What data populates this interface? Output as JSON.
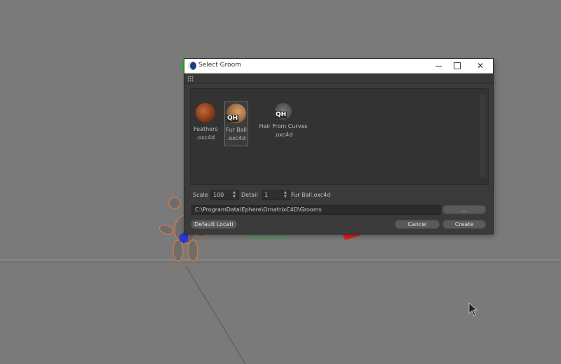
{
  "dialog": {
    "title": "Select Groom",
    "items": [
      {
        "name": "Feathers",
        "ext": ".oxc4d"
      },
      {
        "name": "Fur Ball",
        "ext": ".oxc4d",
        "badge": "QH",
        "selected": true
      },
      {
        "name": "Hair From Curves",
        "ext": ".oxc4d",
        "badge": "QH"
      }
    ],
    "scale_label": "Scale",
    "scale_value": "100",
    "detail_label": "Detail",
    "detail_value": "1",
    "selected_name": "Fur Ball.oxc4d",
    "path": "C:\\ProgramData\\Ephere\\OrnatrixC4D\\Grooms",
    "browse_label": "...",
    "default_label": "Default Locati",
    "cancel_label": "Cancel",
    "create_label": "Create"
  },
  "colors": {
    "viewport_bg": "#7a7a7a",
    "dialog_bg": "#3a3a3a",
    "axis_y": "#22c022",
    "axis_x": "#e02020",
    "handle_z": "#2a36d8"
  }
}
